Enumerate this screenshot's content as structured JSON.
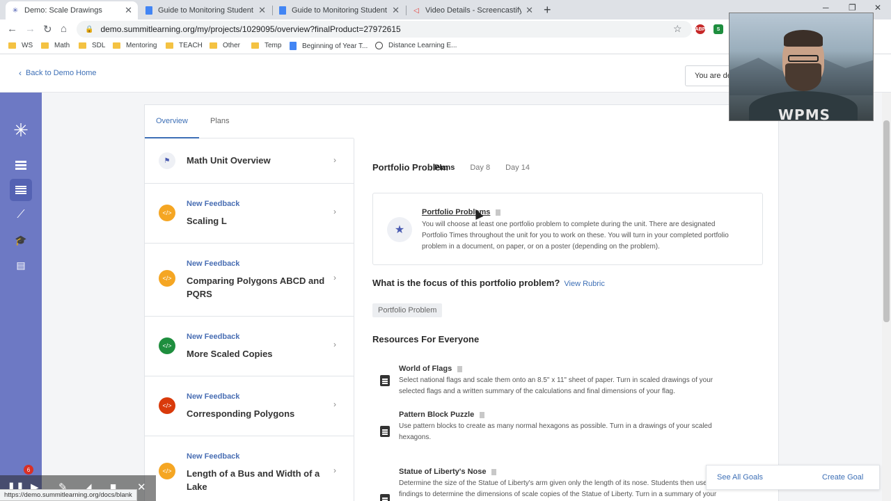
{
  "browser": {
    "tabs": [
      {
        "label": "Demo: Scale Drawings",
        "icon": "summit-asterisk-icon",
        "active": true
      },
      {
        "label": "Guide to Monitoring Student Pro",
        "icon": "google-docs-icon",
        "active": false
      },
      {
        "label": "Guide to Monitoring Student Pro",
        "icon": "google-docs-icon",
        "active": false
      },
      {
        "label": "Video Details - Screencastify",
        "icon": "screencastify-icon",
        "active": false
      }
    ],
    "new_tab": "+",
    "url": "demo.summitlearning.org/my/projects/1029095/overview?finalProduct=27972615",
    "bookmarks": [
      {
        "label": "WS",
        "type": "folder"
      },
      {
        "label": "Math",
        "type": "folder"
      },
      {
        "label": "SDL",
        "type": "folder"
      },
      {
        "label": "Mentoring",
        "type": "folder"
      },
      {
        "label": "TEACH",
        "type": "folder"
      },
      {
        "label": "Other",
        "type": "folder"
      },
      {
        "label": "Temp",
        "type": "folder"
      },
      {
        "label": "Beginning of Year T...",
        "type": "doc"
      },
      {
        "label": "Distance Learning E...",
        "type": "globe"
      }
    ],
    "extension_abp": "ABP",
    "extension_s": "S",
    "status_url": "https://demo.summitlearning.org/docs/blank"
  },
  "header": {
    "back_link": "Back to Demo Home",
    "demo_button": "You are demo"
  },
  "tabs": {
    "overview": "Overview",
    "plans": "Plans"
  },
  "units": [
    {
      "badge": "",
      "title": "Math Unit Overview",
      "icon": "flag-icon",
      "color": "#eef0f5"
    },
    {
      "badge": "New Feedback",
      "title": "Scaling L",
      "icon": "code-icon",
      "color": "#f5a623"
    },
    {
      "badge": "New Feedback",
      "title": "Comparing Polygons ABCD and PQRS",
      "icon": "code-icon",
      "color": "#f5a623"
    },
    {
      "badge": "New Feedback",
      "title": "More Scaled Copies",
      "icon": "code-icon",
      "color": "#1e8e3e"
    },
    {
      "badge": "New Feedback",
      "title": "Corresponding Polygons",
      "icon": "code-icon",
      "color": "#d93a0b"
    },
    {
      "badge": "New Feedback",
      "title": "Length of a Bus and Width of a Lake",
      "icon": "code-icon",
      "color": "#f5a623"
    }
  ],
  "detail": {
    "title": "Portfolio Problem",
    "plan_tabs": [
      "Plans",
      "Day 8",
      "Day 14"
    ],
    "portfolio": {
      "link": "Portfolio Problems",
      "description": "You will choose at least one portfolio problem to complete during the unit. There are designated Portfolio Times throughout the unit for you to work on these. You will turn in your completed portfolio problem in a document, on paper, or on a poster (depending on the problem)."
    },
    "focus_title": "What is the focus of this portfolio problem?",
    "view_rubric": "View Rubric",
    "chip": "Portfolio Problem",
    "resources_title": "Resources For Everyone",
    "resources": [
      {
        "name": "World of Flags",
        "description": "Select national flags and scale them onto an 8.5\" x 11\" sheet of paper.  Turn in scaled drawings of your selected flags and a written summary of the calculations and final dimensions of your flag."
      },
      {
        "name": "Pattern Block Puzzle",
        "description": "Use pattern blocks to create as many normal hexagons as possible.  Turn in a drawings of your scaled hexagons."
      },
      {
        "name": "Statue of Liberty's Nose",
        "description": "Determine the size of the Statue of Liberty's arm given only the length of its nose. Students then use their findings to determine the dimensions of scale copies of the Statue of Liberty.  Turn in a summary of your"
      }
    ]
  },
  "goals": {
    "see_all": "See All Goals",
    "create": "Create Goal"
  },
  "webcam": {
    "shirt_text": "WPMS"
  },
  "recorder": {
    "notification_count": "6"
  }
}
